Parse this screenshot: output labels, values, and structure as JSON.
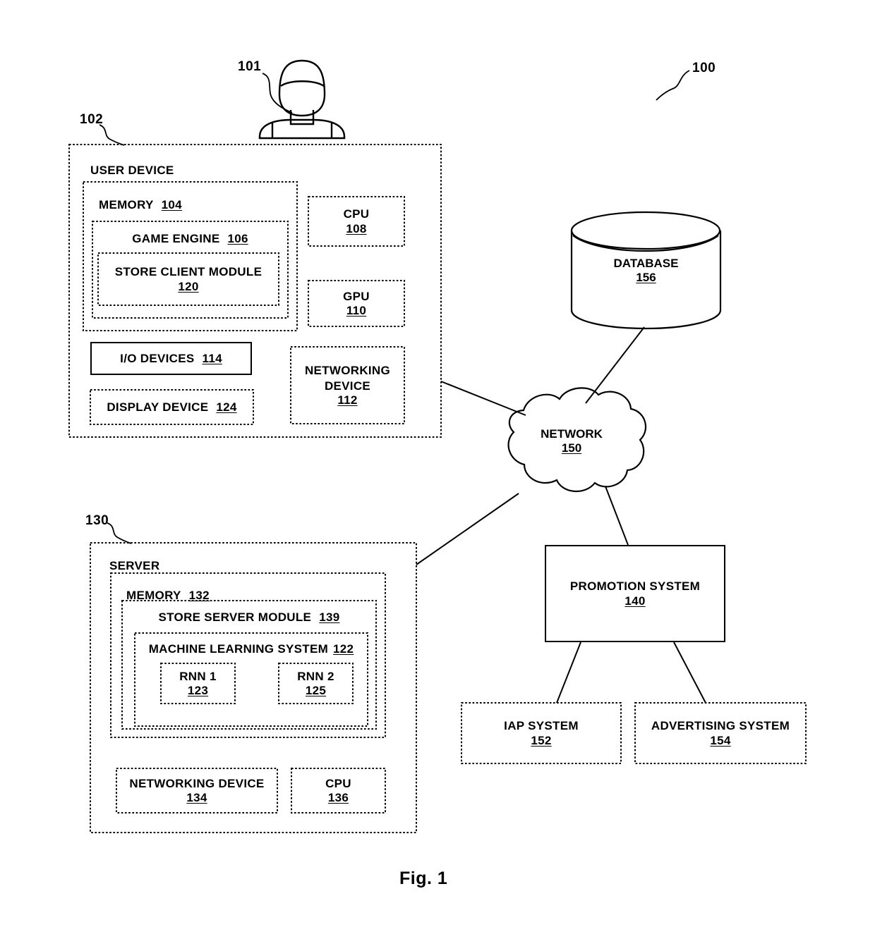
{
  "figure": {
    "caption": "Fig. 1",
    "system_ref": "100"
  },
  "actors": {
    "user": {
      "ref": "101",
      "icon": "user-person-icon"
    }
  },
  "user_device": {
    "ref": "102",
    "title": "USER DEVICE",
    "memory": {
      "title": "MEMORY",
      "num": "104",
      "game_engine": {
        "title": "GAME ENGINE",
        "num": "106",
        "store_client_module": {
          "title": "STORE CLIENT MODULE",
          "num": "120"
        }
      }
    },
    "cpu": {
      "title": "CPU",
      "num": "108"
    },
    "gpu": {
      "title": "GPU",
      "num": "110"
    },
    "io_devices": {
      "title": "I/O DEVICES",
      "num": "114"
    },
    "display_device": {
      "title": "DISPLAY DEVICE",
      "num": "124"
    },
    "networking_device": {
      "title": "NETWORKING DEVICE",
      "num": "112"
    }
  },
  "server": {
    "ref": "130",
    "title": "SERVER",
    "memory": {
      "title": "MEMORY",
      "num": "132",
      "store_server_module": {
        "title": "STORE SERVER MODULE",
        "num": "139",
        "machine_learning_system": {
          "title": "MACHINE LEARNING SYSTEM",
          "num": "122",
          "rnn1": {
            "title": "RNN 1",
            "num": "123"
          },
          "rnn2": {
            "title": "RNN 2",
            "num": "125"
          }
        }
      }
    },
    "networking_device": {
      "title": "NETWORKING DEVICE",
      "num": "134"
    },
    "cpu": {
      "title": "CPU",
      "num": "136"
    }
  },
  "network": {
    "title": "NETWORK",
    "num": "150",
    "shape": "cloud"
  },
  "database": {
    "title": "DATABASE",
    "num": "156",
    "shape": "cylinder"
  },
  "promotion_system": {
    "title": "PROMOTION SYSTEM",
    "num": "140"
  },
  "iap_system": {
    "title": "IAP SYSTEM",
    "num": "152"
  },
  "advertising_system": {
    "title": "ADVERTISING SYSTEM",
    "num": "154"
  },
  "colors": {
    "stroke": "#000000",
    "background": "#ffffff"
  }
}
